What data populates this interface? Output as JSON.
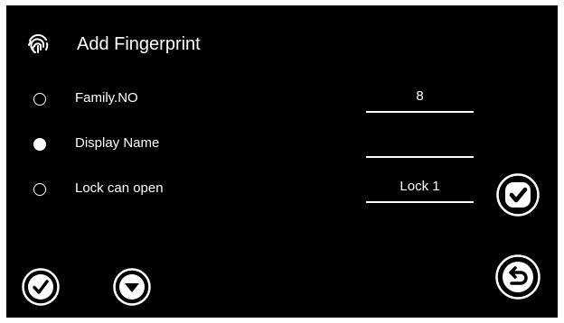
{
  "header": {
    "icon": "fingerprint-icon",
    "title": "Add Fingerprint"
  },
  "form": {
    "rows": [
      {
        "label": "Family.NO",
        "value": "8",
        "selected": false
      },
      {
        "label": "Display Name",
        "value": "",
        "selected": true
      },
      {
        "label": "Lock can open",
        "value": "Lock 1",
        "selected": false
      }
    ]
  },
  "buttons": {
    "confirm_icon": "check-square-icon",
    "ok_icon": "check-circle-icon",
    "next_icon": "chevron-down-circle-icon",
    "back_icon": "back-arrow-circle-icon"
  },
  "colors": {
    "background": "#000000",
    "foreground": "#ffffff"
  }
}
